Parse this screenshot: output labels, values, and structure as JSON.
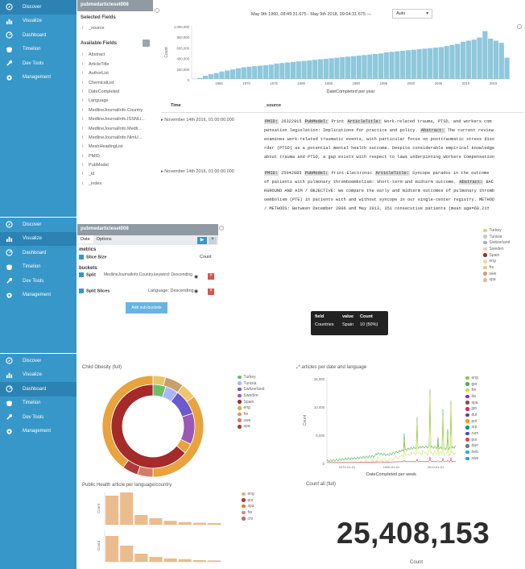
{
  "nav": [
    {
      "label": "Discover",
      "icon": "compass-icon"
    },
    {
      "label": "Visualize",
      "icon": "bar-chart-icon"
    },
    {
      "label": "Dashboard",
      "icon": "dashboard-icon"
    },
    {
      "label": "Timelion",
      "icon": "timelion-icon"
    },
    {
      "label": "Dev Tools",
      "icon": "wrench-icon"
    },
    {
      "label": "Management",
      "icon": "gear-icon"
    }
  ],
  "discover": {
    "index_name": "pubmedarticleset008",
    "selected_fields_title": "Selected Fields",
    "selected_field": "_source",
    "available_fields_title": "Available Fields",
    "fields": [
      "Abstract",
      "ArticleTitle",
      "AuthorList",
      "ChemicalList",
      "DateCompleted",
      "Language",
      "MedlineJournalInfo.Country",
      "MedlineJournalInfo.ISSNLi...",
      "MedlineJournalInfo.Medli...",
      "MedlineJournalInfo.NlmU...",
      "MeshHeadingList",
      "PMID",
      "PubModel",
      "_id",
      "_index"
    ],
    "time_range": "May 9th 1960, 08:49:31.675 - May 9th 2018, 09:04:31.675 —",
    "interval": "Auto",
    "chart_ylabel": "Count",
    "chart_xlabel": "DateCompleted per year",
    "col_time": "Time",
    "col_source": "_source",
    "docs": [
      {
        "time": "November 14th 2016, 01:00:00.000",
        "lines": [
          [
            [
              "PMID:",
              "hl"
            ],
            [
              " 26322915 ",
              ""
            ],
            [
              "PubModel:",
              "hl"
            ],
            [
              " Print ",
              ""
            ],
            [
              "ArticleTitle:",
              "hl"
            ],
            [
              " Work-related trauma, PTSD, and workers com",
              ""
            ]
          ],
          [
            [
              "pensation legislation: Implications for practice and policy. ",
              ""
            ],
            [
              "Abstract:",
              "hl"
            ],
            [
              " The current review",
              ""
            ]
          ],
          [
            [
              "examines work-related traumatic events, with particular focus on posttraumatic stress diso",
              ""
            ]
          ],
          [
            [
              "rder (PTSD) as a potential mental health outcome. Despite considerable empirical knowledge",
              ""
            ]
          ],
          [
            [
              "about trauma and PTSD, a gap exists with respect to laws underpinning Workers Compensation",
              ""
            ]
          ]
        ]
      },
      {
        "time": "November 14th 2016, 01:00:00.000",
        "lines": [
          [
            [
              "PMID:",
              "hl"
            ],
            [
              " 25042885 ",
              ""
            ],
            [
              "PubModel:",
              "hl"
            ],
            [
              " Print-Electronic ",
              ""
            ],
            [
              "ArticleTitle:",
              "hl"
            ],
            [
              " Syncope paradox in the outcome",
              ""
            ]
          ],
          [
            [
              "of patients with pulmonary thromboembolism: short-term and midterm outcome. ",
              ""
            ],
            [
              "Abstract:",
              "hl"
            ],
            [
              " BAC",
              ""
            ]
          ],
          [
            [
              "KGROUND AND AIM / OBJECTIVE: We compare the early and midterm outcomes of pulmonary thromb",
              ""
            ]
          ],
          [
            [
              "oembolism (PTE) in patients with and without syncope in our single-center registry. METHOD",
              ""
            ]
          ],
          [
            [
              "/ METHODS: Between December 2006 and May 2013, 351 consecutive patients (mean age=60.21±",
              ""
            ]
          ]
        ]
      }
    ]
  },
  "visualize": {
    "index_name": "pubmedarticleset008",
    "tabs": [
      "Data",
      "Options"
    ],
    "metrics_title": "metrics",
    "metric_label": "Slice Size",
    "metric_value": "Count",
    "buckets_title": "buckets",
    "split1_label": "Split",
    "split1_value": "MedlineJournalInfo.Country.keyword: Descending",
    "split2_label": "Split Slices",
    "split2_value": "Language: Descending",
    "add_button": "Add sub-buckets",
    "tooltip": {
      "h1": "field",
      "h2": "value",
      "h3": "Count",
      "c1": "Countries",
      "c2": "Spain",
      "c3": "10 (50%)"
    },
    "legend": [
      {
        "name": "Turkey",
        "color": "#e7c990"
      },
      {
        "name": "Tunisia",
        "color": "#c9c9c9"
      },
      {
        "name": "Switzerland",
        "color": "#b2a3e6"
      },
      {
        "name": "Sweden",
        "color": "#f4cfa3"
      },
      {
        "name": "Spain",
        "color": "#9b2d2a"
      },
      {
        "name": "eng",
        "color": "#eed79f"
      },
      {
        "name": "fre",
        "color": "#f3c36b"
      },
      {
        "name": "swe",
        "color": "#d49a82"
      },
      {
        "name": "spa",
        "color": "#e8b0a0"
      }
    ]
  },
  "dashboard": {
    "donut_title": "Child Obesity (full)",
    "donut_legend": [
      {
        "name": "Turkey",
        "color": "#6dbd6a"
      },
      {
        "name": "Tunisia",
        "color": "#aab4ff"
      },
      {
        "name": "Switzerland",
        "color": "#6a5acd"
      },
      {
        "name": "Sweden",
        "color": "#9b59b6"
      },
      {
        "name": "Spain",
        "color": "#a52a2a"
      },
      {
        "name": "eng",
        "color": "#e8a33d"
      },
      {
        "name": "fre",
        "color": "#c7a06a"
      },
      {
        "name": "swe",
        "color": "#d87b6a"
      },
      {
        "name": "spa",
        "color": "#b03a3a"
      }
    ],
    "line_title": "articles per date and language",
    "line_ylabel": "Count",
    "line_xlabel": "DateCompleted per week",
    "line_legend": [
      {
        "name": "eng",
        "color": "#8bc34a"
      },
      {
        "name": "ger",
        "color": "#4caf50"
      },
      {
        "name": "fre",
        "color": "#cddc39"
      },
      {
        "name": "ita",
        "color": "#9c27b0"
      },
      {
        "name": "spa",
        "color": "#795548"
      },
      {
        "name": "jpn",
        "color": "#e91e63"
      },
      {
        "name": "dut",
        "color": "#673ab7"
      },
      {
        "name": "pol",
        "color": "#ff9800"
      },
      {
        "name": "srp",
        "color": "#009688"
      },
      {
        "name": "rum",
        "color": "#3f51b5"
      },
      {
        "name": "por",
        "color": "#f44336"
      },
      {
        "name": "dan",
        "color": "#607d8b"
      },
      {
        "name": "heb",
        "color": "#00bcd4"
      },
      {
        "name": "swe",
        "color": "#2196f3"
      }
    ],
    "bars_title": "Public Health article per language/country",
    "bars_legend": [
      {
        "name": "eng",
        "color": "#e8b07a"
      },
      {
        "name": "por",
        "color": "#c0392b"
      },
      {
        "name": "spa",
        "color": "#e67e22"
      },
      {
        "name": "fre",
        "color": "#d98880"
      },
      {
        "name": "chi",
        "color": "#c06a6a"
      }
    ],
    "bars_ylabel": "Count",
    "count_all_label": "Count all (full)",
    "big_number": "25,408,153",
    "big_number_label": "Count"
  }
}
